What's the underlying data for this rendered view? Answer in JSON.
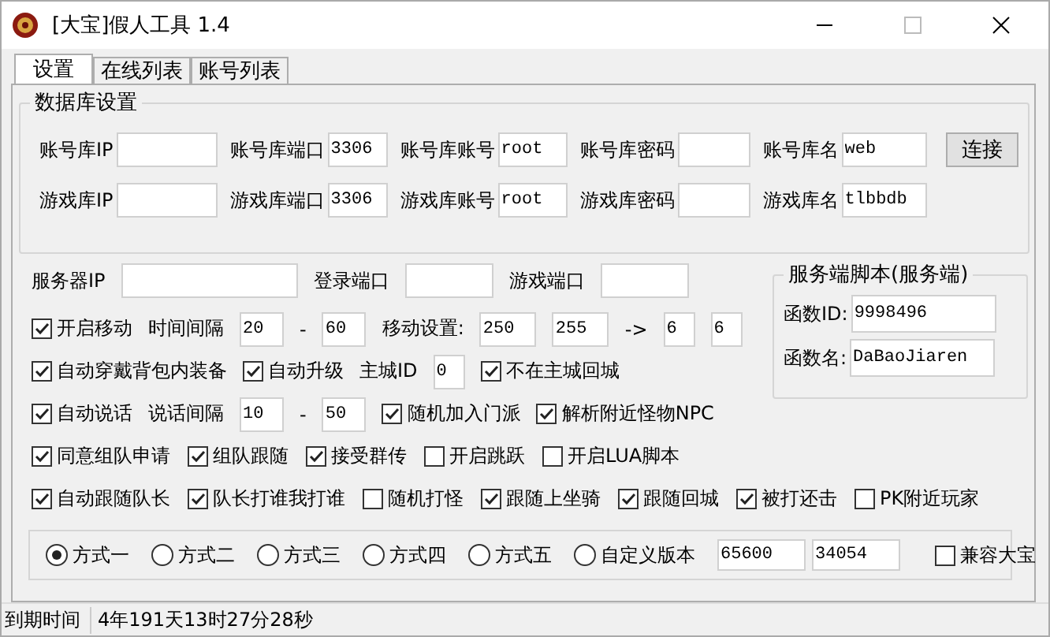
{
  "window": {
    "title": "[大宝]假人工具 1.4"
  },
  "tabs": [
    {
      "label": "设置",
      "selected": true
    },
    {
      "label": "在线列表",
      "selected": false
    },
    {
      "label": "账号列表",
      "selected": false
    }
  ],
  "database": {
    "title": "数据库设置",
    "rows": [
      [
        {
          "label": "账号库IP"
        },
        {
          "label": "账号库端口",
          "value": "3306"
        },
        {
          "label": "账号库账号",
          "value": "root"
        },
        {
          "label": "账号库密码"
        },
        {
          "label": "账号库名",
          "value": "web"
        }
      ],
      [
        {
          "label": "游戏库IP"
        },
        {
          "label": "游戏库端口",
          "value": "3306"
        },
        {
          "label": "游戏库账号",
          "value": "root"
        },
        {
          "label": "游戏库密码"
        },
        {
          "label": "游戏库名",
          "value": "tlbbdb"
        }
      ]
    ],
    "connect_button": "连接"
  },
  "server": [
    {
      "label": "服务器IP"
    },
    {
      "label": "登录端口"
    },
    {
      "label": "游戏端口"
    }
  ],
  "script": {
    "title": "服务端脚本(服务端)",
    "fields": [
      {
        "label": "函数ID:",
        "value": "9998496"
      },
      {
        "label": "函数名:",
        "value": "DaBaoJiaren"
      }
    ]
  },
  "option_rows": [
    [
      {
        "kind": "checkbox",
        "label": "开启移动",
        "checked": true
      },
      {
        "kind": "label",
        "text": "时间间隔"
      },
      {
        "kind": "input",
        "value": "20"
      },
      {
        "kind": "label",
        "text": "-"
      },
      {
        "kind": "input",
        "value": "60"
      },
      {
        "kind": "label",
        "text": "移动设置:"
      },
      {
        "kind": "input",
        "value": "250"
      },
      {
        "kind": "input",
        "value": "255"
      },
      {
        "kind": "label",
        "text": "->"
      },
      {
        "kind": "input",
        "value": "6"
      },
      {
        "kind": "input",
        "value": "6"
      }
    ],
    [
      {
        "kind": "checkbox",
        "label": "自动穿戴背包内装备",
        "checked": true
      },
      {
        "kind": "checkbox",
        "label": "自动升级",
        "checked": true
      },
      {
        "kind": "label",
        "text": "主城ID"
      },
      {
        "kind": "input",
        "value": "0"
      },
      {
        "kind": "checkbox",
        "label": "不在主城回城",
        "checked": true
      }
    ],
    [
      {
        "kind": "checkbox",
        "label": "自动说话",
        "checked": true
      },
      {
        "kind": "label",
        "text": "说话间隔"
      },
      {
        "kind": "input",
        "value": "10"
      },
      {
        "kind": "label",
        "text": "-"
      },
      {
        "kind": "input",
        "value": "50"
      },
      {
        "kind": "checkbox",
        "label": "随机加入门派",
        "checked": true
      },
      {
        "kind": "checkbox",
        "label": "解析附近怪物NPC",
        "checked": true
      }
    ],
    [
      {
        "kind": "checkbox",
        "label": "同意组队申请",
        "checked": true
      },
      {
        "kind": "checkbox",
        "label": "组队跟随",
        "checked": true
      },
      {
        "kind": "checkbox",
        "label": "接受群传",
        "checked": true
      },
      {
        "kind": "checkbox",
        "label": "开启跳跃",
        "checked": false
      },
      {
        "kind": "checkbox",
        "label": "开启LUA脚本",
        "checked": false
      }
    ],
    [
      {
        "kind": "checkbox",
        "label": "自动跟随队长",
        "checked": true
      },
      {
        "kind": "checkbox",
        "label": "队长打谁我打谁",
        "checked": true
      },
      {
        "kind": "checkbox",
        "label": "随机打怪",
        "checked": false
      },
      {
        "kind": "checkbox",
        "label": "跟随上坐骑",
        "checked": true
      },
      {
        "kind": "checkbox",
        "label": "跟随回城",
        "checked": true
      },
      {
        "kind": "checkbox",
        "label": "被打还击",
        "checked": true
      },
      {
        "kind": "checkbox",
        "label": "PK附近玩家",
        "checked": false
      }
    ]
  ],
  "mode": {
    "options": [
      {
        "label": "方式一",
        "selected": true
      },
      {
        "label": "方式二",
        "selected": false
      },
      {
        "label": "方式三",
        "selected": false
      },
      {
        "label": "方式四",
        "selected": false
      },
      {
        "label": "方式五",
        "selected": false
      },
      {
        "label": "自定义版本",
        "selected": false
      }
    ],
    "inputs": [
      "65600",
      "34054"
    ],
    "compat": {
      "label": "兼容大宝",
      "checked": false
    }
  },
  "status_bar": {
    "label": "到期时间",
    "value": "4年191天13时27分28秒"
  }
}
